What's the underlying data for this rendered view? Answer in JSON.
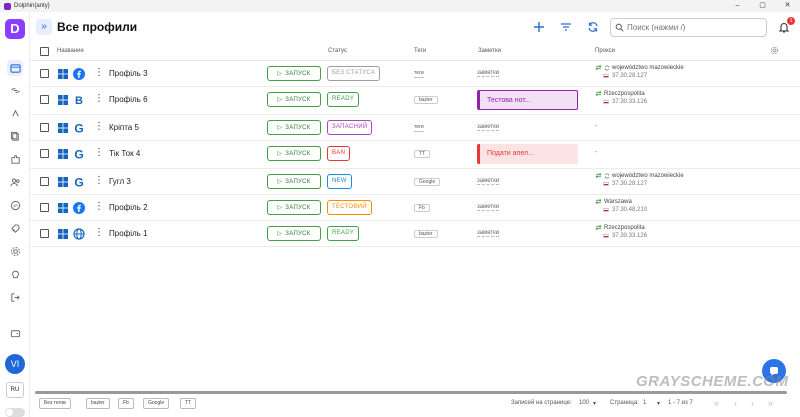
{
  "window": {
    "title": "Dolphin{anty}",
    "controls": [
      "–",
      "▢",
      "✕"
    ]
  },
  "sidebar": {
    "logo": "D",
    "avatar": "VI",
    "lang": "RU"
  },
  "header": {
    "title": "Все профили",
    "search_placeholder": "Поиск (нажми /)",
    "notifications": "1"
  },
  "columns": {
    "name": "Название",
    "status": "Статус",
    "tags": "Теги",
    "notes": "Заметки",
    "proxy": "Прокси"
  },
  "run_label": "ЗАПУСК",
  "rows": [
    {
      "name": "Профіль 3",
      "os": "windows",
      "browser": "facebook",
      "status": "БЕЗ СТАТУСА",
      "status_color": "#9e9e9e",
      "tag": "теги",
      "tag_plain": true,
      "notes": "заметки",
      "proxy_region": "województwo mazowieckie",
      "proxy_ip": "37.30.28.127"
    },
    {
      "name": "Профіль 6",
      "os": "windows",
      "browser": "bing",
      "status": "READY",
      "status_color": "#43a047",
      "tag": "bazier",
      "tag_plain": false,
      "note_card": "Тестова нот...",
      "note_color": "#8e24aa",
      "proxy_region": "Rzeczpospolita",
      "proxy_ip": "37.30.33.126"
    },
    {
      "name": "Кріпта 5",
      "os": "windows",
      "browser": "google",
      "status": "ЗАПАСНИЙ",
      "status_color": "#ab47bc",
      "tag": "теги",
      "tag_plain": true,
      "notes": "заметки",
      "proxy_empty": "-"
    },
    {
      "name": "Тік Ток 4",
      "os": "windows",
      "browser": "google",
      "status": "BAN",
      "status_color": "#e53935",
      "tag": "TT",
      "tag_plain": false,
      "note_card": "Подати апел...",
      "note_color": "#e53935",
      "proxy_empty": "-"
    },
    {
      "name": "Гугл 3",
      "os": "windows",
      "browser": "google",
      "status": "NEW",
      "status_color": "#1e88e5",
      "tag": "Google",
      "tag_plain": false,
      "notes": "заметки",
      "proxy_region": "województwo mazowieckie",
      "proxy_ip": "37.30.28.127"
    },
    {
      "name": "Профіль 2",
      "os": "windows",
      "browser": "facebook",
      "status": "ТЕСТОВИЙ",
      "status_color": "#fb8c00",
      "tag": "Fb",
      "tag_plain": false,
      "notes": "заметки",
      "proxy_region": "Warszawa",
      "proxy_ip": "37.30.48.210"
    },
    {
      "name": "Профіль 1",
      "os": "windows",
      "browser": "globe",
      "status": "READY",
      "status_color": "#43a047",
      "tag": "bazier",
      "tag_plain": false,
      "notes": "заметки",
      "proxy_region": "Rzeczpospolita",
      "proxy_ip": "37.30.33.126"
    }
  ],
  "footer": {
    "chips": [
      "Без тегов",
      "bazier",
      "Fb",
      "Google",
      "TT"
    ],
    "per_page_label": "Записей на странице:",
    "per_page": "100",
    "page_label": "Страница:",
    "page": "1",
    "range": "1 - 7 из 7"
  },
  "watermark": "GRAYSCHEME.COM"
}
